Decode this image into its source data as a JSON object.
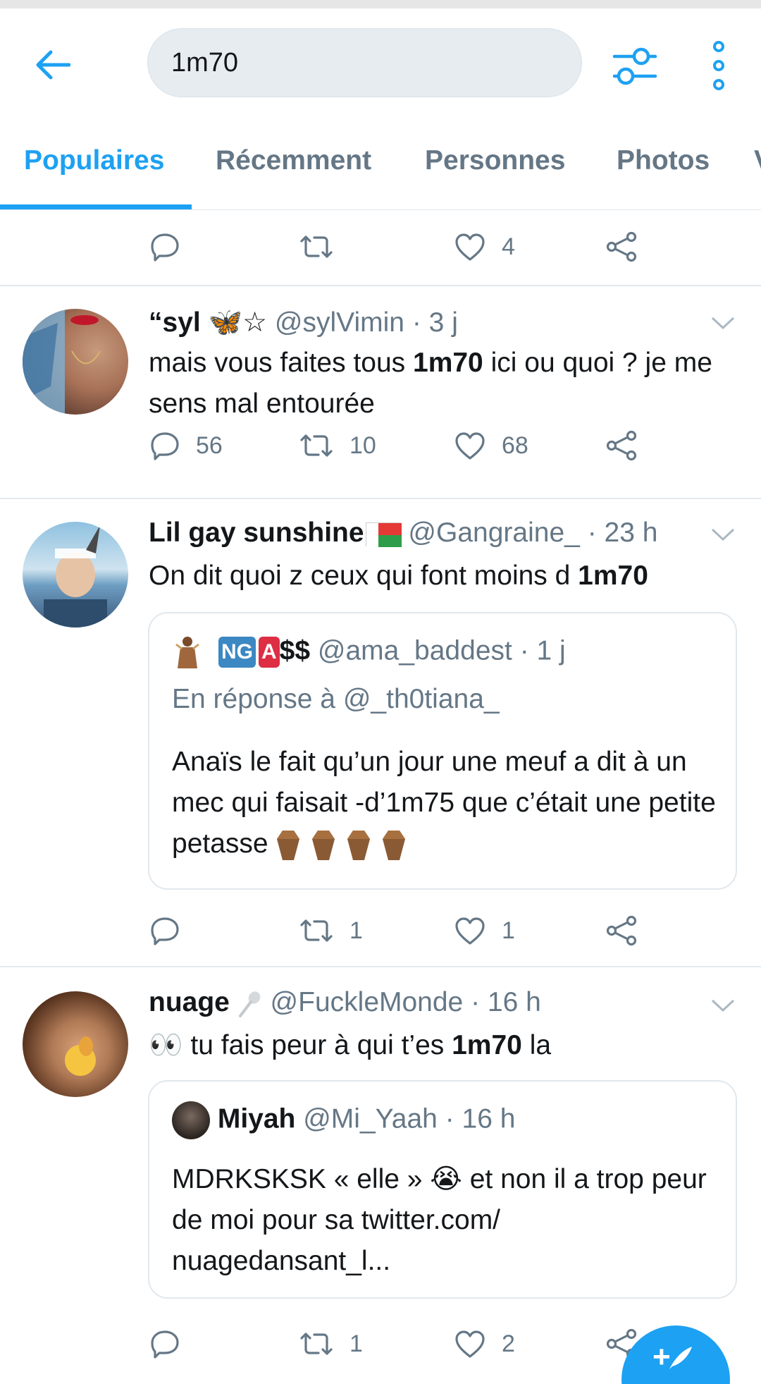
{
  "search": {
    "query": "1m70"
  },
  "tabs": [
    {
      "label": "Populaires",
      "active": true
    },
    {
      "label": "Récemment"
    },
    {
      "label": "Personnes"
    },
    {
      "label": "Photos"
    },
    {
      "label": "V"
    }
  ],
  "top_actions": {
    "reply": "",
    "retweet": "",
    "like": "4"
  },
  "tweets": [
    {
      "name": "“syl 🦋☆",
      "handle": "@sylVimin",
      "time": "· 3 j",
      "text_before": "mais vous faites tous ",
      "text_bold": "1m70",
      "text_after": " ici ou quoi ? je me sens mal entourée",
      "replies": "56",
      "retweets": "10",
      "likes": "68"
    },
    {
      "name": "Lil gay sunshine",
      "handle": "@Gangraine_",
      "time": "· 23 h",
      "text_before": "On dit quoi z ceux qui font moins d ",
      "text_bold": "1m70",
      "text_after": "",
      "quote": {
        "badge1": "NG",
        "badge2": "A",
        "name_suffix": "$$",
        "handle": "@ama_baddest",
        "time": "· 1 j",
        "reply_to": "En réponse à @_th0tiana_",
        "text": "Anaïs le fait qu’un jour une meuf a dit à un mec qui faisait -d’1m75 que c’était une petite petasse"
      },
      "replies": "",
      "retweets": "1",
      "likes": "1"
    },
    {
      "name": "nuage",
      "handle": "@FuckleMonde",
      "time": "· 16 h",
      "text_before": "👀 tu fais peur à qui t’es ",
      "text_bold": "1m70",
      "text_after": " la",
      "quote": {
        "name": "Miyah",
        "handle": "@Mi_Yaah",
        "time": "· 16 h",
        "text": "MDRKSKSK « elle » 😭 et non il a trop peur de moi pour sa twitter.com/ nuagedansant_l..."
      },
      "replies": "",
      "retweets": "1",
      "likes": "2"
    }
  ],
  "colors": {
    "accent": "#1da1f2",
    "muted": "#657786",
    "divider": "#e1e8ed"
  }
}
